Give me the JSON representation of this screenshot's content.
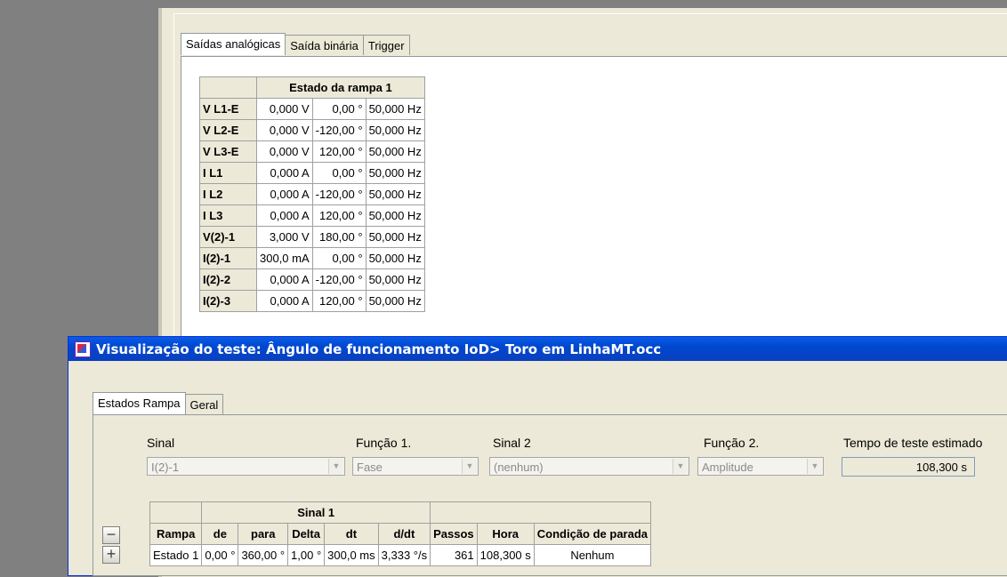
{
  "back_tabs": [
    "Saídas analógicas",
    "Saída binária",
    "Trigger"
  ],
  "analog_table": {
    "header": "Estado da rampa 1",
    "rows": [
      {
        "label": "V L1-E",
        "amp": "0,000 V",
        "phase": "0,00 °",
        "freq": "50,000 Hz"
      },
      {
        "label": "V L2-E",
        "amp": "0,000 V",
        "phase": "-120,00 °",
        "freq": "50,000 Hz"
      },
      {
        "label": "V L3-E",
        "amp": "0,000 V",
        "phase": "120,00 °",
        "freq": "50,000 Hz"
      },
      {
        "label": "I L1",
        "amp": "0,000 A",
        "phase": "0,00 °",
        "freq": "50,000 Hz"
      },
      {
        "label": "I L2",
        "amp": "0,000 A",
        "phase": "-120,00 °",
        "freq": "50,000 Hz"
      },
      {
        "label": "I L3",
        "amp": "0,000 A",
        "phase": "120,00 °",
        "freq": "50,000 Hz"
      },
      {
        "label": "V(2)-1",
        "amp": "3,000 V",
        "phase": "180,00 °",
        "freq": "50,000 Hz"
      },
      {
        "label": "I(2)-1",
        "amp": "300,0 mA",
        "phase": "0,00 °",
        "freq": "50,000 Hz"
      },
      {
        "label": "I(2)-2",
        "amp": "0,000 A",
        "phase": "-120,00 °",
        "freq": "50,000 Hz"
      },
      {
        "label": "I(2)-3",
        "amp": "0,000 A",
        "phase": "120,00 °",
        "freq": "50,000 Hz"
      }
    ]
  },
  "front": {
    "title": "Visualização do teste: Ângulo de funcionamento IoD> Toro em LinhaMT.occ",
    "tabs": [
      "Estados Rampa",
      "Geral"
    ],
    "labels": {
      "sinal": "Sinal",
      "funcao1": "Função 1.",
      "sinal2": "Sinal 2",
      "funcao2": "Função 2.",
      "tempo": "Tempo de teste estimado"
    },
    "values": {
      "sinal": "I(2)-1",
      "funcao1": "Fase",
      "sinal2": "(nenhum)",
      "funcao2": "Amplitude",
      "tempo": "108,300 s"
    },
    "ramp_table": {
      "group": "Sinal 1",
      "headers": [
        "Rampa",
        "de",
        "para",
        "Delta",
        "dt",
        "d/dt",
        "Passos",
        "Hora",
        "Condição de parada"
      ],
      "row": [
        "Estado 1",
        "0,00 °",
        "360,00 °",
        "1,00 °",
        "300,0 ms",
        "3,333 °/s",
        "361",
        "108,300 s",
        "Nenhum"
      ]
    }
  }
}
